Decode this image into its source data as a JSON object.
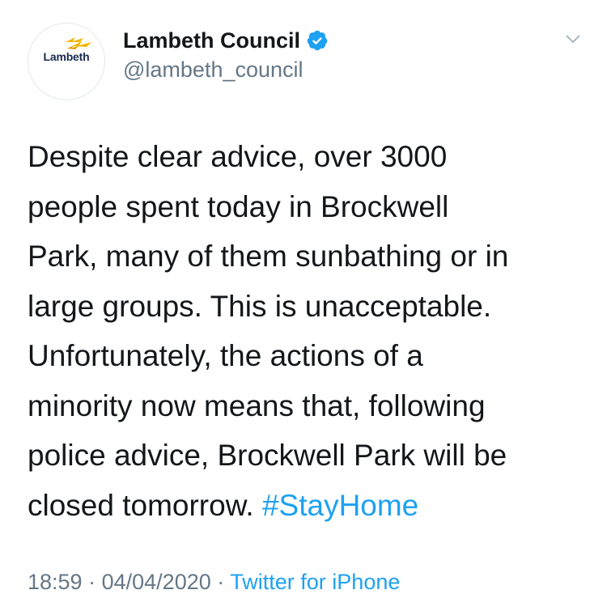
{
  "account": {
    "display_name": "Lambeth Council",
    "handle": "@lambeth_council",
    "avatar_text": "Lambeth",
    "verified": true
  },
  "tweet": {
    "lines": [
      "Despite clear advice, over 3000",
      "people spent today in Brockwell",
      "Park, many of them sunbathing or in",
      "large groups. This is unacceptable.",
      "Unfortunately, the actions of a",
      "minority now means that, following",
      "police advice, Brockwell Park will be",
      "closed tomorrow."
    ],
    "hashtag": "#StayHome"
  },
  "meta": {
    "time": "18:59",
    "separator": "·",
    "date": "04/04/2020",
    "source": "Twitter for iPhone"
  },
  "icons": {
    "verified": "verified-badge-icon",
    "menu": "chevron-down-icon"
  },
  "colors": {
    "link": "#1da1f2",
    "secondary_text": "#657786",
    "primary_text": "#14171a",
    "logo_accent": "#f2b705",
    "logo_text": "#1a2a4f"
  }
}
